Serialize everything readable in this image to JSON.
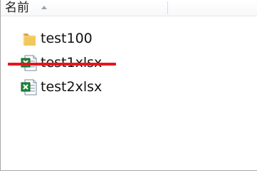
{
  "column_header": {
    "name_label": "名前",
    "sort_direction": "ascending"
  },
  "files": [
    {
      "name": "test100",
      "type": "folder",
      "icon": "folder-icon"
    },
    {
      "name": "test1xlsx",
      "type": "excel",
      "icon": "excel-file-icon",
      "struck_through": true
    },
    {
      "name": "test2xlsx",
      "type": "excel",
      "icon": "excel-file-icon"
    }
  ],
  "colors": {
    "strike_line": "#e8141c",
    "folder": "#e8b84a",
    "excel_green": "#1d8a3a"
  }
}
